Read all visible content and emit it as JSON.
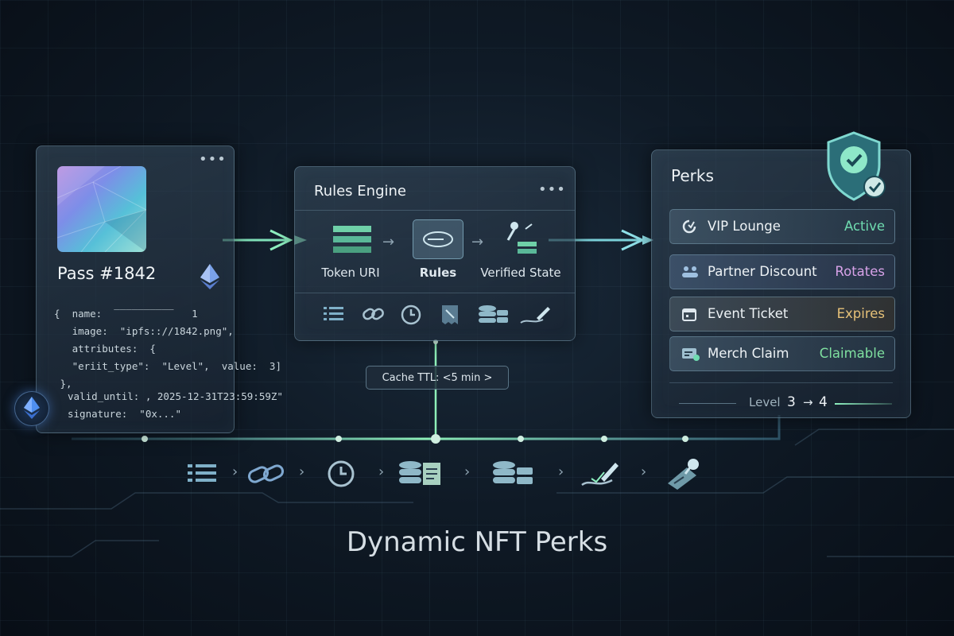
{
  "title": "Dynamic NFT Perks",
  "pass": {
    "name": "Pass #1842",
    "metadata_lines": [
      "{  name:  ‾‾‾‾‾‾‾‾‾‾   1",
      "   image:  \"ipfs:://1842.png\",",
      "   attributes:  {",
      "   \"eriit_type\":  \"Level\",  value:  3]",
      " },"
    ],
    "tail_lines": [
      "valid_until: , 2025-12-31T23:59:59Z\"",
      "signature:  \"0x...\""
    ],
    "icon": "ethereum-icon"
  },
  "rules_engine": {
    "title": "Rules Engine",
    "steps": [
      {
        "label": "Token URI",
        "icon": "document-lines-icon"
      },
      {
        "label": "Rules",
        "icon": "rules-loop-icon",
        "highlighted": true
      },
      {
        "label": "Verified State",
        "icon": "verified-stamp-icon"
      }
    ],
    "tools": [
      "list-icon",
      "link-icon",
      "clock-icon",
      "receipt-icon",
      "database-icon",
      "pen-sign-icon"
    ]
  },
  "cache": {
    "label": "Cache TTL: <5 min >"
  },
  "perks": {
    "title": "Perks",
    "badge_icon": "shield-check-icon",
    "items": [
      {
        "name": "VIP Lounge",
        "status": "Active",
        "color": "#6fdcb0",
        "icon": "lounge-icon"
      },
      {
        "name": "Partner Discount",
        "status": "Rotates",
        "color": "#d7a2e8",
        "icon": "people-icon"
      },
      {
        "name": "Event Ticket",
        "status": "Expires",
        "color": "#e6c178",
        "icon": "calendar-icon"
      },
      {
        "name": "Merch Claim",
        "status": "Claimable",
        "color": "#7fe0a0",
        "icon": "merch-icon"
      }
    ],
    "level_label": "Level",
    "level_from": "3",
    "level_arrow": "→",
    "level_to": "4"
  },
  "pipeline_icons": [
    "list-icon",
    "link-icon",
    "clock-icon",
    "database-receipt-icon",
    "database-icon",
    "pen-sign-icon",
    "stamp-icon"
  ],
  "colors": {
    "accent_green": "#6fdcb0",
    "accent_teal": "#7ad0d8",
    "background": "#0f1a26"
  }
}
